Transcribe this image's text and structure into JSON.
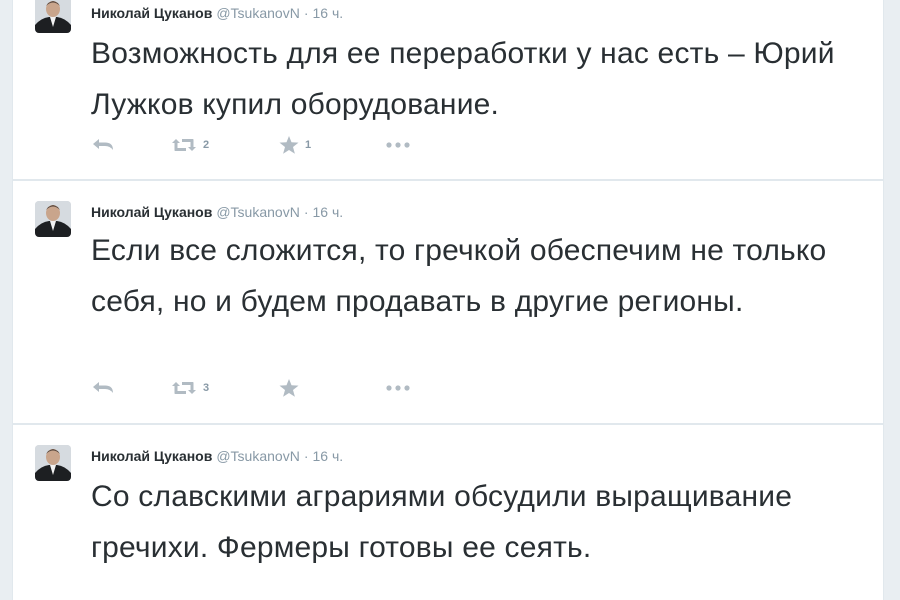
{
  "colors": {
    "background": "#e9eef2",
    "card": "#ffffff",
    "text": "#292f33",
    "muted": "#8899a6",
    "icon": "#b1bbc3"
  },
  "icons": [
    "reply-icon",
    "retweet-icon",
    "favorite-icon",
    "more-icon"
  ],
  "tweets": [
    {
      "author_name": "Николай Цуканов",
      "author_handle": "@TsukanovN",
      "separator": "·",
      "time": "16 ч.",
      "text": "Возможность для ее переработки у нас есть – Юрий Лужков купил оборудование.",
      "retweets": "2",
      "favorites": "1"
    },
    {
      "author_name": "Николай Цуканов",
      "author_handle": "@TsukanovN",
      "separator": "·",
      "time": "16 ч.",
      "text": "Если все сложится, то гречкой обеспечим не только себя, но и будем продавать в другие регионы.",
      "retweets": "3",
      "favorites": ""
    },
    {
      "author_name": "Николай Цуканов",
      "author_handle": "@TsukanovN",
      "separator": "·",
      "time": "16 ч.",
      "text": "Со славскими аграриями обсудили выращивание гречихи. Фермеры готовы ее сеять.",
      "retweets": "",
      "favorites": ""
    }
  ]
}
